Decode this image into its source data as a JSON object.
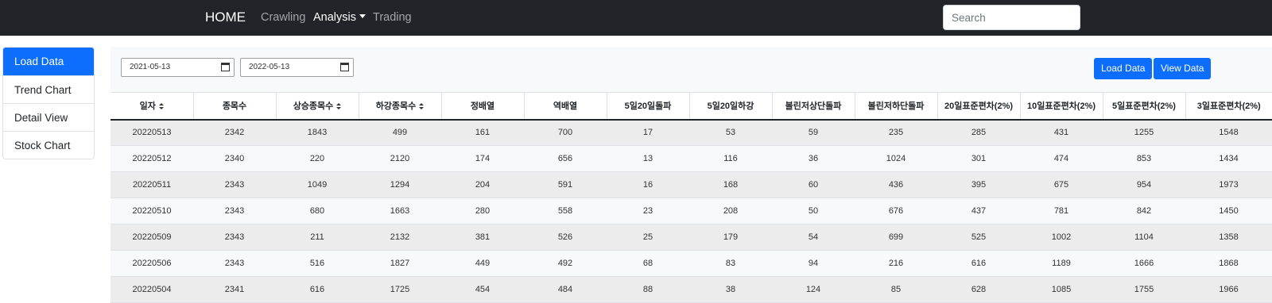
{
  "navbar": {
    "brand": "HOME",
    "links": [
      {
        "label": "Crawling"
      },
      {
        "label": "Analysis"
      },
      {
        "label": "Trading"
      }
    ],
    "search_placeholder": "Search"
  },
  "sidebar": {
    "items": [
      {
        "label": "Load Data"
      },
      {
        "label": "Trend Chart"
      },
      {
        "label": "Detail View"
      },
      {
        "label": "Stock Chart"
      }
    ]
  },
  "filters": {
    "start_date": "2021-05-13",
    "end_date": "2022-05-13",
    "load_button": "Load Data",
    "view_button": "View Data"
  },
  "table": {
    "columns": [
      "일자",
      "종목수",
      "상승종목수",
      "하강종목수",
      "정배열",
      "역배열",
      "5일20일돌파",
      "5일20일하강",
      "볼린저상단돌파",
      "볼린저하단돌파",
      "20일표준편차(2%)",
      "10일표준편차(2%)",
      "5일표준편차(2%)",
      "3일표준편차(2%)"
    ],
    "rows": [
      [
        "20220513",
        "2342",
        "1843",
        "499",
        "161",
        "700",
        "17",
        "53",
        "59",
        "235",
        "285",
        "431",
        "1255",
        "1548"
      ],
      [
        "20220512",
        "2340",
        "220",
        "2120",
        "174",
        "656",
        "13",
        "116",
        "36",
        "1024",
        "301",
        "474",
        "853",
        "1434"
      ],
      [
        "20220511",
        "2343",
        "1049",
        "1294",
        "204",
        "591",
        "16",
        "168",
        "60",
        "436",
        "395",
        "675",
        "954",
        "1973"
      ],
      [
        "20220510",
        "2343",
        "680",
        "1663",
        "280",
        "558",
        "23",
        "208",
        "50",
        "676",
        "437",
        "781",
        "842",
        "1450"
      ],
      [
        "20220509",
        "2343",
        "211",
        "2132",
        "381",
        "526",
        "25",
        "179",
        "54",
        "699",
        "525",
        "1002",
        "1104",
        "1358"
      ],
      [
        "20220506",
        "2343",
        "516",
        "1827",
        "449",
        "492",
        "68",
        "83",
        "94",
        "216",
        "616",
        "1189",
        "1666",
        "1868"
      ],
      [
        "20220504",
        "2341",
        "616",
        "1725",
        "454",
        "484",
        "88",
        "38",
        "124",
        "85",
        "628",
        "1085",
        "1755",
        "1966"
      ]
    ]
  }
}
